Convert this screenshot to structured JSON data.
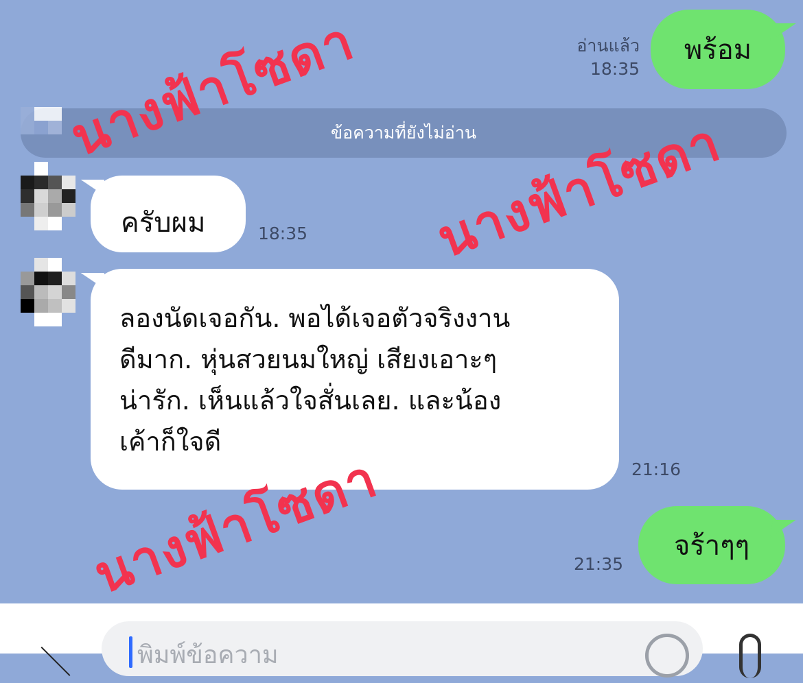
{
  "messages": {
    "m1": {
      "text": "พร้อม",
      "read_label": "อ่านแล้ว",
      "time": "18:35"
    },
    "m2": {
      "text": "ครับผม",
      "time": "18:35"
    },
    "m3": {
      "lines": [
        "ลองนัดเจอกัน.  พอได้เจอตัวจริงงาน",
        "ดีมาก. หุ่นสวยนมใหญ่ เสียงเอาะๆ",
        "น่ารัก. เห็นแล้วใจสั่นเลย. และน้อง",
        "เค้าก็ใจดี"
      ],
      "time": "21:16"
    },
    "m4": {
      "text": "จร้าๆๆ",
      "time": "21:35"
    }
  },
  "unread_divider": "ข้อความที่ยังไม่อ่าน",
  "watermark": "นางฟ้าโซดา",
  "input": {
    "placeholder": "พิมพ์ข้อความ"
  },
  "icons": {
    "back": "chevron-icon",
    "emoji": "emoji-icon",
    "attach": "paperclip-icon"
  },
  "colors": {
    "background": "#8fa9d8",
    "outgoing": "#6fe36f",
    "incoming": "#ffffff",
    "watermark": "#f2334f"
  }
}
